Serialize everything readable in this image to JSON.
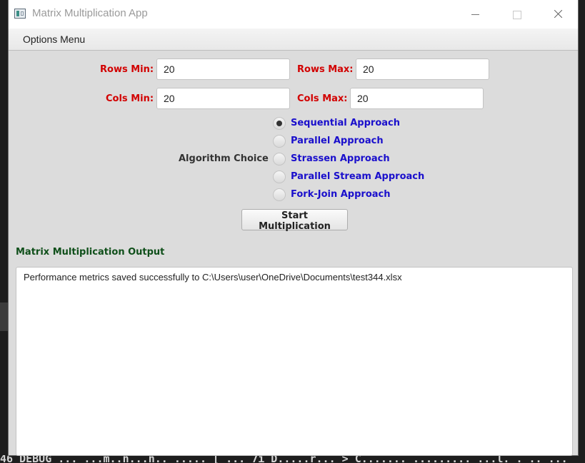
{
  "window": {
    "title": "Matrix Multiplication App"
  },
  "menu": {
    "items": [
      "Options Menu"
    ]
  },
  "form": {
    "rows_min": {
      "label": "Rows Min:",
      "value": "20"
    },
    "rows_max": {
      "label": "Rows Max:",
      "value": "20"
    },
    "cols_min": {
      "label": "Cols Min:",
      "value": "20"
    },
    "cols_max": {
      "label": "Cols Max:",
      "value": "20"
    }
  },
  "algorithm": {
    "label": "Algorithm Choice",
    "options": [
      {
        "label": "Sequential Approach",
        "selected": true
      },
      {
        "label": "Parallel Approach",
        "selected": false
      },
      {
        "label": "Strassen Approach",
        "selected": false
      },
      {
        "label": "Parallel Stream Approach",
        "selected": false
      },
      {
        "label": "Fork-Join Approach",
        "selected": false
      }
    ]
  },
  "start_button": {
    "label": "Start Multiplication"
  },
  "output": {
    "title": "Matrix Multiplication Output",
    "text": "Performance metrics saved successfully to C:\\Users\\user\\OneDrive\\Documents\\test344.xlsx"
  },
  "background": {
    "bottom_text": "46 DEBUG ... ...m..n...n.. ..... [ ... 7i D.....r... > C....... ......... ...l. . .. ..."
  },
  "colors": {
    "field_label": "#d20000",
    "radio_label": "#1a0fcc",
    "output_title": "#0f4f1a"
  }
}
